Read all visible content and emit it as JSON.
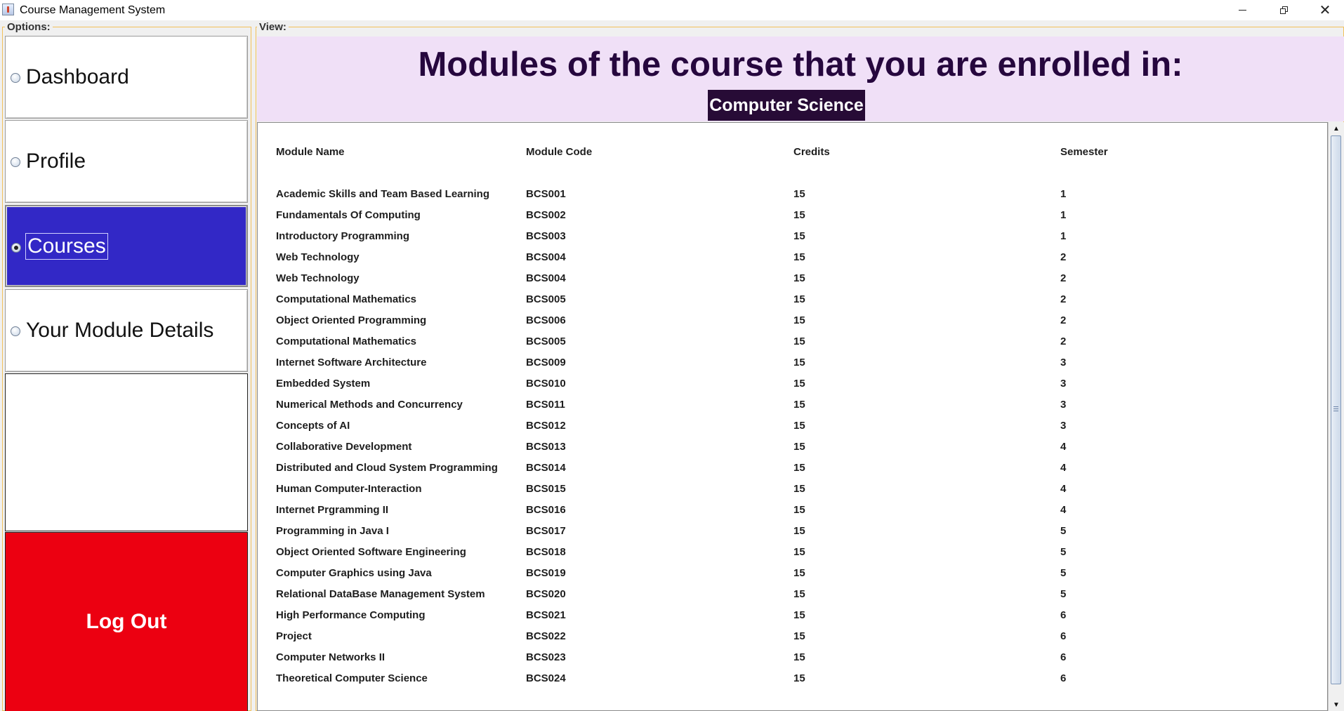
{
  "window": {
    "title": "Course Management System",
    "controls": {
      "minimize": "—",
      "close": "✕"
    }
  },
  "options_label": "Options:",
  "view_label": "View:",
  "sidebar": {
    "items": [
      {
        "label": "Dashboard",
        "selected": false
      },
      {
        "label": "Profile",
        "selected": false
      },
      {
        "label": "Courses",
        "selected": true
      },
      {
        "label": "Your Module Details",
        "selected": false
      }
    ],
    "logout_label": "Log Out"
  },
  "colors": {
    "selected_nav": "#3228c6",
    "logout": "#ec0011",
    "header_bg": "#f0e0f7",
    "title_color": "#26073e",
    "badge_bg": "#270b36"
  },
  "header": {
    "title": "Modules of the course that you are enrolled in:",
    "course": "Computer Science"
  },
  "table": {
    "columns": [
      "Module Name",
      "Module Code",
      "Credits",
      "Semester"
    ],
    "rows": [
      [
        "Academic Skills and Team Based Learning",
        "BCS001",
        "15",
        "1"
      ],
      [
        "Fundamentals Of Computing",
        "BCS002",
        "15",
        "1"
      ],
      [
        "Introductory Programming",
        "BCS003",
        "15",
        "1"
      ],
      [
        "Web Technology",
        "BCS004",
        "15",
        "2"
      ],
      [
        "Web Technology",
        "BCS004",
        "15",
        "2"
      ],
      [
        "Computational Mathematics",
        "BCS005",
        "15",
        "2"
      ],
      [
        "Object Oriented Programming",
        "BCS006",
        "15",
        "2"
      ],
      [
        "Computational Mathematics",
        "BCS005",
        "15",
        "2"
      ],
      [
        "Internet Software Architecture",
        "BCS009",
        "15",
        "3"
      ],
      [
        "Embedded System",
        "BCS010",
        "15",
        "3"
      ],
      [
        "Numerical Methods and Concurrency",
        "BCS011",
        "15",
        "3"
      ],
      [
        "Concepts of AI",
        "BCS012",
        "15",
        "3"
      ],
      [
        "Collaborative Development",
        "BCS013",
        "15",
        "4"
      ],
      [
        "Distributed and Cloud System Programming",
        "BCS014",
        "15",
        "4"
      ],
      [
        "Human Computer-Interaction",
        "BCS015",
        "15",
        "4"
      ],
      [
        "Internet Prgramming II",
        "BCS016",
        "15",
        "4"
      ],
      [
        "Programming in Java I",
        "BCS017",
        "15",
        "5"
      ],
      [
        "Object Oriented Software Engineering",
        "BCS018",
        "15",
        "5"
      ],
      [
        "Computer Graphics using Java",
        "BCS019",
        "15",
        "5"
      ],
      [
        "Relational DataBase Management System",
        "BCS020",
        "15",
        "5"
      ],
      [
        "High Performance Computing",
        "BCS021",
        "15",
        "6"
      ],
      [
        "Project",
        "BCS022",
        "15",
        "6"
      ],
      [
        "Computer Networks II",
        "BCS023",
        "15",
        "6"
      ],
      [
        "Theoretical Computer Science",
        "BCS024",
        "15",
        "6"
      ]
    ]
  },
  "scrollbar": {
    "up_icon": "▲",
    "down_icon": "▼"
  }
}
